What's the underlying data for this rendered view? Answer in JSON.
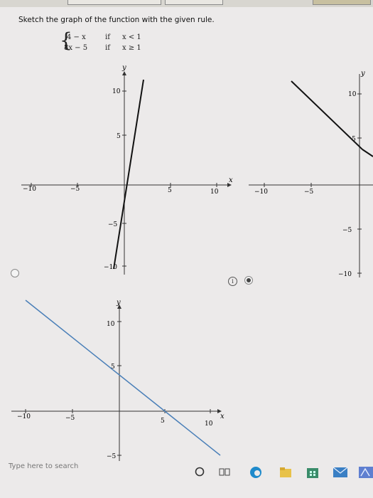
{
  "question": {
    "text": "Sketch the graph of the function with the given rule.",
    "piecewise": [
      {
        "expr": "4 − x",
        "cond_word": "if",
        "cond": "x < 1"
      },
      {
        "expr": "8x − 5",
        "cond_word": "if",
        "cond": "x ≥ 1"
      }
    ]
  },
  "graphs": [
    {
      "id": "option-1",
      "selected": false,
      "axis_x_label": "x",
      "axis_y_label": "y",
      "tick_labels": {
        "x": [
          "−10",
          "−5",
          "5",
          "10"
        ],
        "y": [
          "10",
          "5",
          "−5",
          "−10"
        ]
      }
    },
    {
      "id": "option-2",
      "selected": true,
      "axis_y_label": "y",
      "tick_labels": {
        "x": [
          "−10",
          "−5"
        ],
        "y": [
          "10",
          "5",
          "−5",
          "−10"
        ]
      }
    },
    {
      "id": "option-3",
      "selected": false,
      "axis_x_label": "x",
      "axis_y_label": "y",
      "tick_labels": {
        "x": [
          "−10",
          "−5",
          "5",
          "10"
        ],
        "y": [
          "10",
          "5",
          "−5"
        ]
      }
    }
  ],
  "info_icon": "i",
  "taskbar": {
    "search_placeholder": "Type here to search",
    "icons": [
      "cortana-circle-icon",
      "task-view-icon",
      "edge-icon",
      "folder-icon",
      "store-icon",
      "mail-icon",
      "app-icon"
    ]
  },
  "colors": {
    "graph_line_black": "#111111",
    "graph_line_blue": "#4a7fb8",
    "page_bg": "#eceaea"
  }
}
